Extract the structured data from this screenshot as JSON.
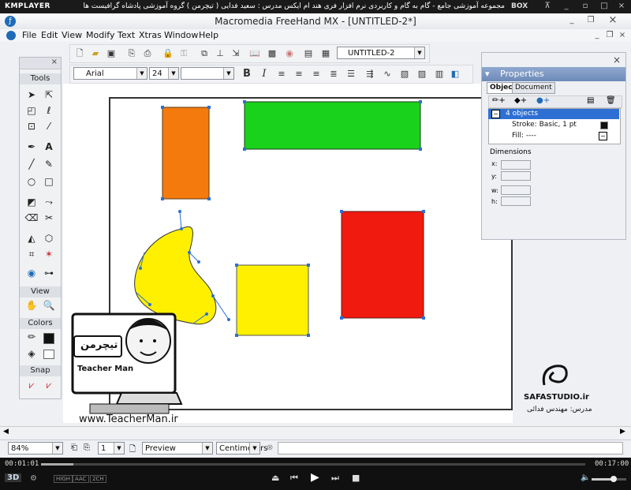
{
  "player": {
    "brand": "KMPLAYER",
    "title": "مجموعه آموزشی جامع - گام به گام و کاربردی نرم افزار فری هند ام ایکس   مدرس : سعید فدایی ( تیچرمن ) گروه آموزشی پادشاه گرافیست ها",
    "box_label": "BOX",
    "time_current": "00:01:01",
    "time_total": "00:17:00",
    "badges": [
      "3D",
      "HIGH",
      "AAC",
      "2CH"
    ]
  },
  "app": {
    "title": "Macromedia FreeHand MX - [UNTITLED-2*]",
    "menu": [
      "File",
      "Edit",
      "View",
      "Modify",
      "Text",
      "Xtras",
      "Window",
      "Help"
    ],
    "document_select": "UNTITLED-2",
    "font_select": "Arial",
    "size_select": "24",
    "style_select": "",
    "zoom": "84%",
    "page_num": "1",
    "preview_mode": "Preview",
    "units": "Centimeters"
  },
  "tools_panel": {
    "title": "Tools",
    "sections": [
      "View",
      "Colors",
      "Snap"
    ]
  },
  "properties": {
    "title": "Properties",
    "tabs": [
      "Object",
      "Document"
    ],
    "rows": [
      "4 objects",
      "Stroke: Basic, 1 pt",
      "Fill: ----"
    ],
    "dimensions_label": "Dimensions",
    "dim_labels": [
      "x:",
      "y:",
      "w:",
      "h:"
    ]
  },
  "watermarks": {
    "teacher_logo": "تیچرمن",
    "teacher_en": "Teacher Man",
    "website": "www.TeacherMan.ir",
    "studio": "SAFASTUDIO.ir",
    "instructor": "مدرس: مهندس فدائی"
  },
  "colors": {
    "orange": "#F47A0E",
    "green": "#19D21B",
    "red": "#F01A0F",
    "yellow": "#FFF000",
    "selection": "#2b6fd6"
  }
}
